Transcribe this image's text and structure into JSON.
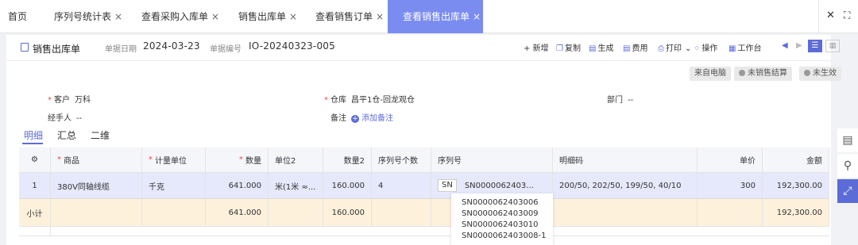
{
  "tabs": [
    {
      "label": "首页",
      "closable": false
    },
    {
      "label": "序列号统计表",
      "closable": true
    },
    {
      "label": "查看采购入库单",
      "closable": true
    },
    {
      "label": "销售出库单",
      "closable": true
    },
    {
      "label": "查看销售订单",
      "closable": true
    },
    {
      "label": "查看销售出库单",
      "closable": true,
      "active": true
    }
  ],
  "close_glyph": "×",
  "window": {
    "close": "✕",
    "expand": "⛶"
  },
  "doc": {
    "title": "销售出库单",
    "date_label": "单据日期",
    "date_value": "2024-03-23",
    "number_label": "单据编号",
    "number_value": "IO-20240323-005"
  },
  "toolbar": [
    "+ 新增",
    "复制",
    "生成",
    "费用",
    "打印",
    "操作",
    "工作台"
  ],
  "badges": {
    "source": "来自电脑",
    "settle": "未销售结算",
    "effect": "未生效"
  },
  "fields": {
    "customer_label": "客户",
    "customer_value": "万科",
    "warehouse_label": "仓库",
    "warehouse_value": "昌平1仓-回龙观仓",
    "department_label": "部门",
    "department_value": "--",
    "handler_label": "经手人",
    "handler_value": "--",
    "remark_label": "备注",
    "remark_action": "添加备注"
  },
  "subtabs": [
    "明细",
    "汇总",
    "二维"
  ],
  "table": {
    "headers": [
      "商品",
      "计量单位",
      "数量",
      "单位2",
      "数量2",
      "序列号个数",
      "序列号",
      "明细码",
      "单价",
      "金额"
    ],
    "rows": [
      [
        "1",
        "380V同轴线缆",
        "千克",
        "641.000",
        "米(1米 ≈...",
        "160.000",
        "4",
        "SN0000062403...",
        "200/50, 202/50, 199/50, 40/10",
        "300",
        "192,300.00"
      ]
    ],
    "sn_tag": "SN",
    "summary": {
      "label": "小计",
      "qty": "641.000",
      "qty2": "160.000",
      "amount": "192,300.00"
    }
  },
  "serial_popup": [
    "SN0000062403006",
    "SN0000062403009",
    "SN0000062403010",
    "SN0000062403008-1"
  ],
  "colors": {
    "accent": "#5b6cd8",
    "active_tab": "#7b8cf0",
    "row_highlight": "#e6e8fb",
    "summary_row": "#fdf1dc",
    "required": "#e34d4d"
  }
}
